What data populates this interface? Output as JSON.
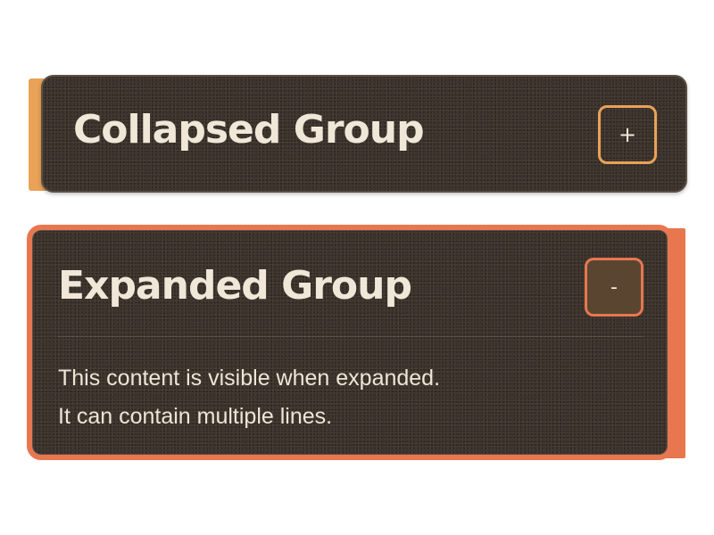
{
  "colors": {
    "card_bg": "#3a3129",
    "collapsed_accent": "#e9a257",
    "expanded_accent": "#e8774f",
    "text": "#f1e7d8"
  },
  "collapsed_group": {
    "title": "Collapsed Group",
    "toggle_label": "+",
    "state": "collapsed"
  },
  "expanded_group": {
    "title": "Expanded Group",
    "toggle_label": "-",
    "state": "expanded",
    "content_lines": [
      "This content is visible when expanded.",
      "It can contain multiple lines."
    ]
  }
}
